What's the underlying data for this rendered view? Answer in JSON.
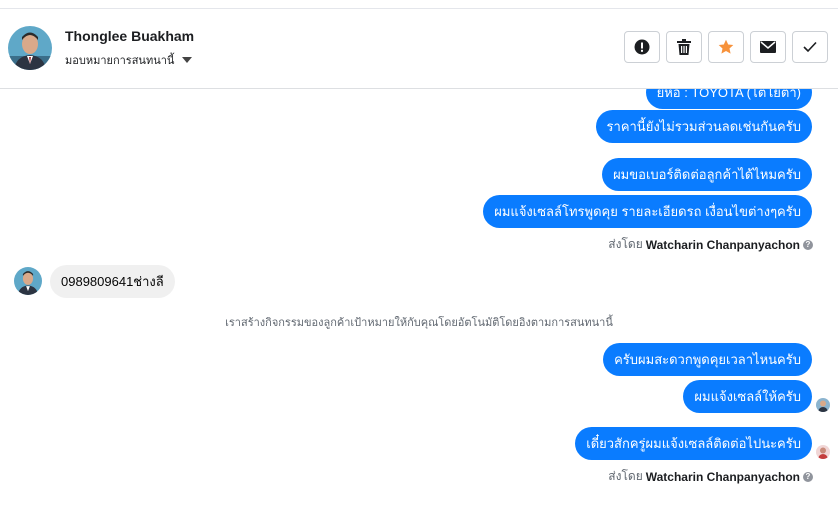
{
  "header": {
    "contact_name": "Thonglee Buakham",
    "assign_label": "มอบหมายการสนทนานี้",
    "actions": [
      {
        "name": "report-icon",
        "label": "Mark as spam"
      },
      {
        "name": "trash-icon",
        "label": "Delete"
      },
      {
        "name": "star-icon",
        "label": "Follow up"
      },
      {
        "name": "envelope-icon",
        "label": "Mark unread"
      },
      {
        "name": "check-icon",
        "label": "Done"
      }
    ],
    "colors": {
      "star": "#f7923b",
      "accent": "#0a7cff"
    }
  },
  "messages": {
    "m0": "ยี่ห้อ : TOYOTA (โตโยต้า)",
    "m1": "ราคานี้ยังไม่รวมส่วนลดเช่นกันครับ",
    "m2": "ผมขอเบอร์ติดต่อลูกค้าได้ไหมครับ",
    "m3": "ผมแจ้งเซลล์โทรพูดคุย รายละเอียดรถ เงื่อนไขต่างๆครับ",
    "sent_by_prefix": "ส่งโดย",
    "sent_by_name": "Watcharin Chanpanyachon",
    "incoming": "0989809641ช่างลี",
    "system_note": "เราสร้างกิจกรรมของลูกค้าเป้าหมายให้กับคุณโดยอัตโนมัติโดยอิงตามการสนทนานี้",
    "m4": "ครับผมสะดวกพูดคุยเวลาไหนครับ",
    "m5": "ผมแจ้งเซลล์ให้ครับ",
    "m6": "เดี๋ยวสักครู่ผมแจ้งเซลล์ติดต่อไปนะครับ"
  }
}
